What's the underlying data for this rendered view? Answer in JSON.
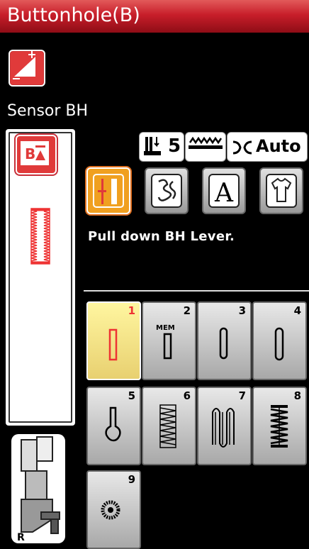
{
  "title": "Buttonhole(B)",
  "sensor_label": "Sensor BH",
  "status": {
    "presser_foot_value": "5",
    "thread_cutter": "Auto"
  },
  "message": "Pull down BH Lever.",
  "buttonholes": [
    {
      "number": "1",
      "selected": true
    },
    {
      "number": "2",
      "mem": "MEM"
    },
    {
      "number": "3"
    },
    {
      "number": "4"
    },
    {
      "number": "5"
    },
    {
      "number": "6"
    },
    {
      "number": "7"
    },
    {
      "number": "8"
    },
    {
      "number": "9"
    }
  ],
  "foot_label": "R",
  "colors": {
    "title_red": "#c81e2a",
    "accent_red": "#e03a3a",
    "selected_orange": "#f0a020",
    "selected_cell_yellow": "#f8e078"
  },
  "icons": {
    "adjust": "adjust-icon",
    "bh_mode": "buttonhole-mode-icon",
    "presser_foot": "presser-foot-icon",
    "feed_dogs": "feed-dog-icon",
    "thread_cutter": "thread-cutter-icon",
    "utility": "utility-stitch-icon",
    "decorative": "decorative-stitch-icon",
    "alphabet": "alphabet-icon",
    "garment": "garment-icon"
  }
}
